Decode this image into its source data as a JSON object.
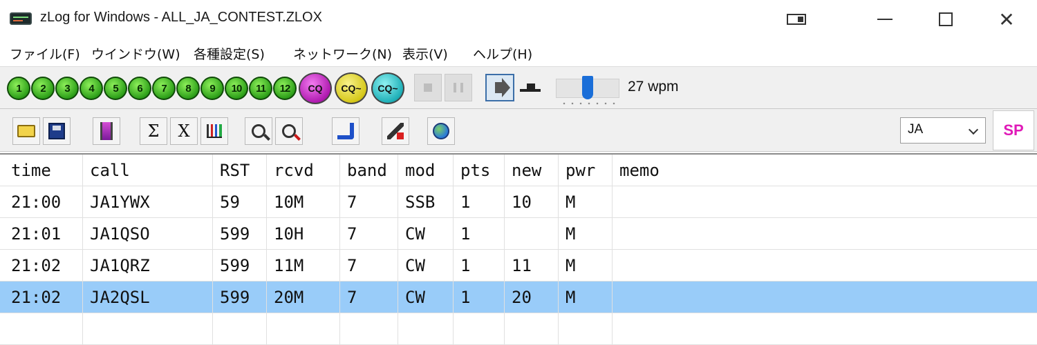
{
  "window": {
    "title": "zLog for Windows  - ALL_JA_CONTEST.ZLOX",
    "close_glyph": "✕"
  },
  "menu": [
    {
      "label": "ファイル(F)"
    },
    {
      "label": "ウインドウ(W)"
    },
    {
      "label": "各種設定(S)"
    },
    {
      "label": "ネットワーク(N)"
    },
    {
      "label": "表示(V)"
    },
    {
      "label": "ヘルプ(H)"
    }
  ],
  "toolbar1": {
    "number_buttons": [
      "1",
      "2",
      "3",
      "4",
      "5",
      "6",
      "7",
      "8",
      "9",
      "10",
      "11",
      "12"
    ],
    "cq_buttons": [
      "CQ",
      "CQ~",
      "CQ~"
    ],
    "cw_speed": "27 wpm",
    "cw_speed_level": 0.5
  },
  "toolbar2": {
    "sigma_label": "Σ",
    "x_label": "X",
    "band_select_value": "JA",
    "sp_label": "SP"
  },
  "grid": {
    "headers": [
      "time",
      "call",
      "RST",
      "rcvd",
      "band",
      "mod",
      "pts",
      "new",
      "pwr",
      "memo"
    ],
    "rows": [
      [
        "21:00",
        "JA1YWX",
        "59",
        "10M",
        "7",
        "SSB",
        "1",
        "10",
        "M",
        ""
      ],
      [
        "21:01",
        "JA1QSO",
        "599",
        "10H",
        "7",
        "CW",
        "1",
        "",
        "M",
        ""
      ],
      [
        "21:02",
        "JA1QRZ",
        "599",
        "11M",
        "7",
        "CW",
        "1",
        "11",
        "M",
        ""
      ],
      [
        "21:02",
        "JA2QSL",
        "599",
        "20M",
        "7",
        "CW",
        "1",
        "20",
        "M",
        ""
      ]
    ],
    "selected_row": 3
  },
  "colors": {
    "selection": "#99ccf9",
    "sp_text": "#e01ab8"
  }
}
